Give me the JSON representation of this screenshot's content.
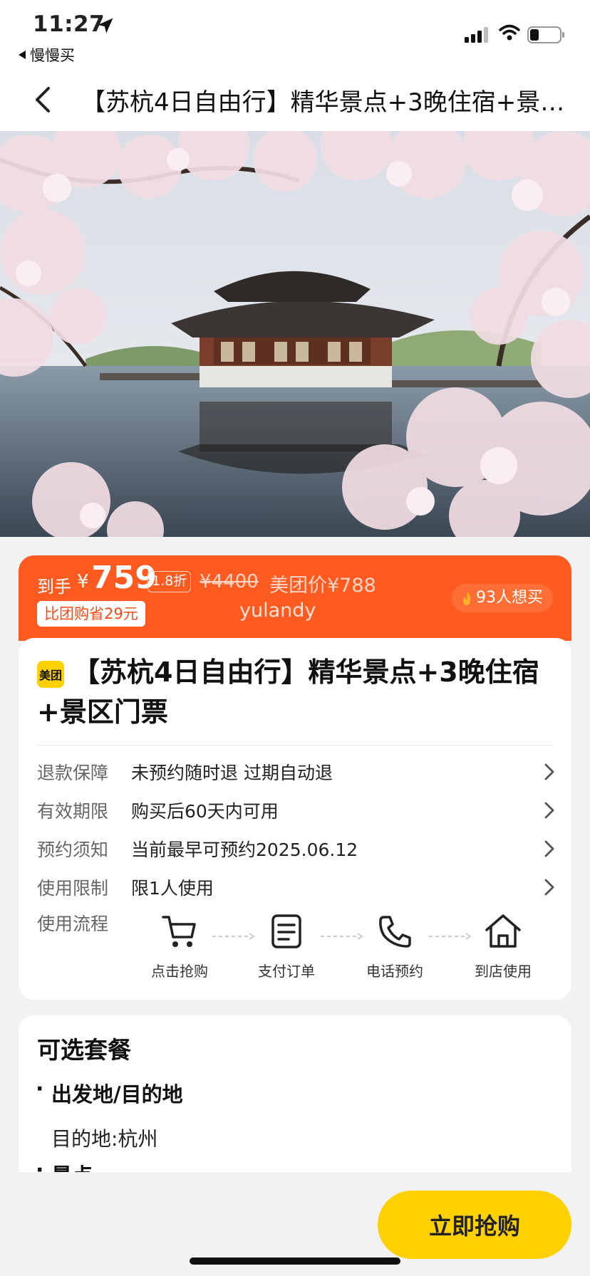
{
  "status_bar": {
    "time": "11:27",
    "back_app": "慢慢买"
  },
  "nav": {
    "title": "【苏杭4日自由行】精华景点+3晚住宿+景区门票"
  },
  "price_banner": {
    "prefix": "到手",
    "currency": "¥",
    "price": "759",
    "discount": "1.8折",
    "original_price": "¥4400",
    "meituan_price": "美团价¥788",
    "save_badge": "比团购省29元",
    "watermark": "yulandy",
    "want_count": "93人想买"
  },
  "product": {
    "brand_badge": "美团",
    "title": "【苏杭4日自由行】精华景点+3晚住宿+景区门票"
  },
  "info_rows": [
    {
      "label": "退款保障",
      "value": "未预约随时退 过期自动退"
    },
    {
      "label": "有效期限",
      "value": "购买后60天内可用"
    },
    {
      "label": "预约须知",
      "value": "当前最早可预约2025.06.12"
    },
    {
      "label": "使用限制",
      "value": "限1人使用"
    }
  ],
  "flow": {
    "label": "使用流程",
    "steps": [
      {
        "text": "点击抢购",
        "icon": "cart-icon"
      },
      {
        "text": "支付订单",
        "icon": "document-icon"
      },
      {
        "text": "电话预约",
        "icon": "phone-icon"
      },
      {
        "text": "到店使用",
        "icon": "home-icon"
      }
    ]
  },
  "packages": {
    "title": "可选套餐",
    "sections": [
      {
        "name": "出发地/目的地",
        "text": "目的地:杭州"
      },
      {
        "name": "景点"
      }
    ]
  },
  "buy_button": "立即抢购",
  "colors": {
    "accent_orange": "#ff5a1f",
    "buy_yellow": "#ffd100",
    "background": "#f2f2f2"
  }
}
